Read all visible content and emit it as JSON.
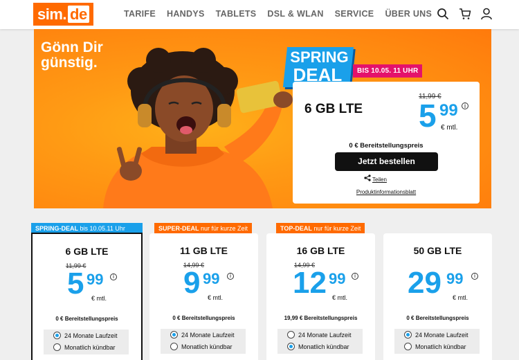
{
  "header": {
    "logo_main": "sim",
    "logo_dot": ".",
    "logo_suffix": "de",
    "nav": [
      "TARIFE",
      "HANDYS",
      "TABLETS",
      "DSL & WLAN",
      "SERVICE",
      "ÜBER UNS"
    ],
    "icons": [
      "search-icon",
      "cart-icon",
      "user-icon"
    ]
  },
  "hero": {
    "title_line1": "Gönn Dir",
    "title_line2": "günstig.",
    "badge_line1": "SPRING",
    "badge_line2": "DEAL",
    "badge_until": "BIS 10.05. 11 UHR",
    "offer": {
      "gb": "6 GB LTE",
      "old_price": "11,99 €",
      "price_main": "5",
      "price_cents": "99",
      "info": "i",
      "unit": "€ mtl.",
      "fee": "0 € Bereitstellungspreis",
      "button": "Jetzt bestellen",
      "share": "Teilen",
      "product_info": "Produktinformationsblatt"
    }
  },
  "cards": [
    {
      "tag_bold": "SPRING-DEAL",
      "tag_light": " bis 10.05.11 Uhr",
      "tag_color": "#1aa0ea",
      "gb": "6 GB LTE",
      "old_price": "11,99 €",
      "price_main": "5",
      "price_cents": "99",
      "unit": "€ mtl.",
      "fee": "0 € Bereitstellungspreis",
      "opt1": "24 Monate Laufzeit",
      "opt2": "Monatlich kündbar",
      "selected": 1
    },
    {
      "tag_bold": "SUPER-DEAL",
      "tag_light": " nur für kurze Zeit",
      "tag_color": "#ff6a00",
      "gb": "11 GB LTE",
      "old_price": "14,99 €",
      "price_main": "9",
      "price_cents": "99",
      "unit": "€ mtl.",
      "fee": "0 € Bereitstellungspreis",
      "opt1": "24 Monate Laufzeit",
      "opt2": "Monatlich kündbar",
      "selected": 1
    },
    {
      "tag_bold": "TOP-DEAL",
      "tag_light": " nur für kurze Zeit",
      "tag_color": "#ff6a00",
      "gb": "16 GB LTE",
      "old_price": "14,99 €",
      "price_main": "12",
      "price_cents": "99",
      "unit": "€ mtl.",
      "fee": "19,99 € Bereitstellungspreis",
      "opt1": "24 Monate Laufzeit",
      "opt2": "Monatlich kündbar",
      "selected": 2
    },
    {
      "tag_bold": "",
      "tag_light": "",
      "tag_color": "",
      "gb": "50 GB LTE",
      "old_price": "",
      "price_main": "29",
      "price_cents": "99",
      "unit": "€ mtl.",
      "fee": "0 € Bereitstellungspreis",
      "opt1": "24 Monate Laufzeit",
      "opt2": "Monatlich kündbar",
      "selected": 1
    }
  ]
}
